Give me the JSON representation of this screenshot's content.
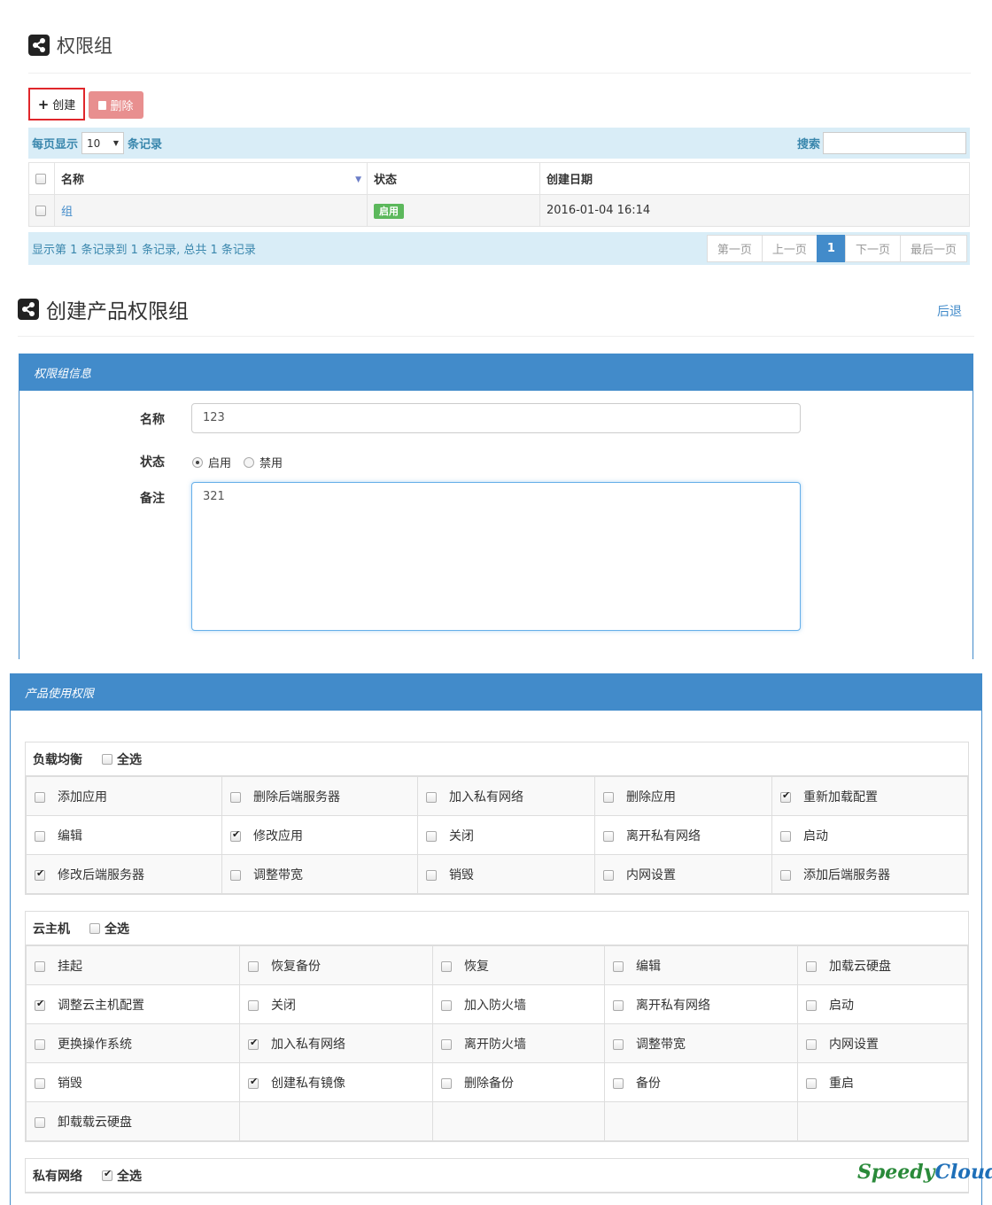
{
  "list_section": {
    "title": "权限组",
    "create_label": "创建",
    "delete_label": "删除",
    "per_page_prefix": "每页显示",
    "per_page_value": "10",
    "per_page_suffix": "条记录",
    "search_label": "搜索",
    "columns": [
      "名称",
      "状态",
      "创建日期"
    ],
    "rows": [
      {
        "name": "组",
        "status": "启用",
        "created": "2016-01-04 16:14"
      }
    ],
    "summary": "显示第 1 条记录到 1 条记录, 总共 1 条记录",
    "pager": {
      "first": "第一页",
      "prev": "上一页",
      "current": "1",
      "next": "下一页",
      "last": "最后一页"
    }
  },
  "create_section": {
    "title": "创建产品权限组",
    "back_label": "后退",
    "panel_title": "权限组信息",
    "name_label": "名称",
    "name_value": "123",
    "status_label": "状态",
    "status_enable": "启用",
    "status_disable": "禁用",
    "status_selected": "启用",
    "remark_label": "备注",
    "remark_value": "321"
  },
  "perm_section": {
    "panel_title": "产品使用权限",
    "select_all_label": "全选",
    "groups": [
      {
        "name": "负载均衡",
        "all_checked": false,
        "rows": [
          [
            {
              "l": "添加应用",
              "c": false
            },
            {
              "l": "删除后端服务器",
              "c": false
            },
            {
              "l": "加入私有网络",
              "c": false
            },
            {
              "l": "删除应用",
              "c": false
            },
            {
              "l": "重新加载配置",
              "c": true
            }
          ],
          [
            {
              "l": "编辑",
              "c": false
            },
            {
              "l": "修改应用",
              "c": true
            },
            {
              "l": "关闭",
              "c": false
            },
            {
              "l": "离开私有网络",
              "c": false
            },
            {
              "l": "启动",
              "c": false
            }
          ],
          [
            {
              "l": "修改后端服务器",
              "c": true
            },
            {
              "l": "调整带宽",
              "c": false
            },
            {
              "l": "销毁",
              "c": false
            },
            {
              "l": "内网设置",
              "c": false
            },
            {
              "l": "添加后端服务器",
              "c": false
            }
          ]
        ]
      },
      {
        "name": "云主机",
        "all_checked": false,
        "rows": [
          [
            {
              "l": "挂起",
              "c": false
            },
            {
              "l": "恢复备份",
              "c": false
            },
            {
              "l": "恢复",
              "c": false
            },
            {
              "l": "编辑",
              "c": false
            },
            {
              "l": "加载云硬盘",
              "c": false
            }
          ],
          [
            {
              "l": "调整云主机配置",
              "c": true
            },
            {
              "l": "关闭",
              "c": false
            },
            {
              "l": "加入防火墙",
              "c": false
            },
            {
              "l": "离开私有网络",
              "c": false
            },
            {
              "l": "启动",
              "c": false
            }
          ],
          [
            {
              "l": "更换操作系统",
              "c": false
            },
            {
              "l": "加入私有网络",
              "c": true
            },
            {
              "l": "离开防火墙",
              "c": false
            },
            {
              "l": "调整带宽",
              "c": false
            },
            {
              "l": "内网设置",
              "c": false
            }
          ],
          [
            {
              "l": "销毁",
              "c": false
            },
            {
              "l": "创建私有镜像",
              "c": true
            },
            {
              "l": "删除备份",
              "c": false
            },
            {
              "l": "备份",
              "c": false
            },
            {
              "l": "重启",
              "c": false
            }
          ],
          [
            {
              "l": "卸载载云硬盘",
              "c": false
            },
            {
              "l": "",
              "c": null
            },
            {
              "l": "",
              "c": null
            },
            {
              "l": "",
              "c": null
            },
            {
              "l": "",
              "c": null
            }
          ]
        ]
      },
      {
        "name": "私有网络",
        "all_checked": true,
        "rows": []
      }
    ]
  },
  "logo": {
    "part1": "Speedy",
    "part2": "Cloud",
    "mark": "®"
  }
}
